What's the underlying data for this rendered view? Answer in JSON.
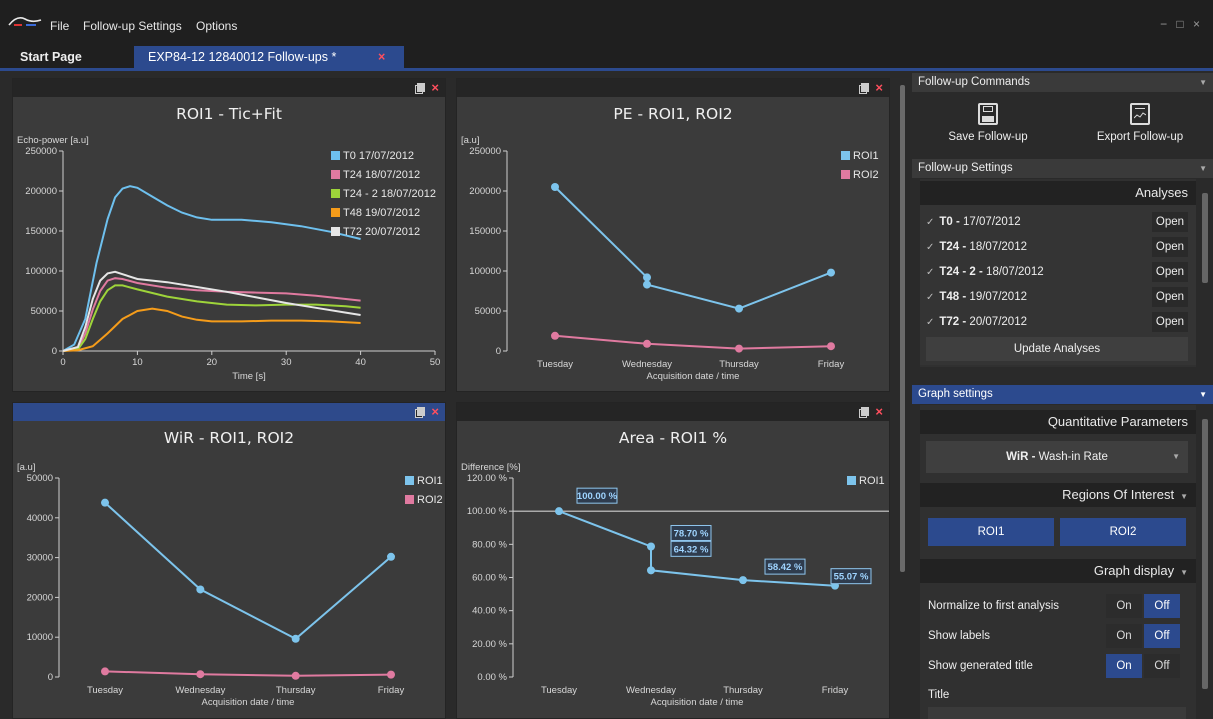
{
  "menu": {
    "items": [
      "File",
      "Follow-up Settings",
      "Options"
    ],
    "window_controls": "− □ ×"
  },
  "tabs": {
    "start": "Start Page",
    "doc": "EXP84-12 12840012 Follow-ups *",
    "close": "×"
  },
  "icons": {
    "panel_detach": "window-icon",
    "panel_close": "close-icon",
    "save": "floppy-disk-icon",
    "export": "clipboard-chart-icon"
  },
  "colors": {
    "accent": "#2c4a8e",
    "close": "#ff4f5e",
    "t0": "#6ec0ee",
    "t24": "#e07aa0",
    "t24_2": "#9ed43a",
    "t48": "#f59c1a",
    "t72": "#e6e6e6",
    "roi1": "#7dc4ec",
    "roi2": "#e07aa0"
  },
  "chart_data": [
    {
      "type": "line",
      "title": "ROI1 - Tic+Fit",
      "xlabel": "Time [s]",
      "ylabel": "Echo-power [a.u]",
      "xlim": [
        0,
        50
      ],
      "ylim": [
        0,
        250000
      ],
      "xticks": [
        "0",
        "10",
        "20",
        "30",
        "40",
        "50"
      ],
      "yticks": [
        "0",
        "50000",
        "100000",
        "150000",
        "200000",
        "250000"
      ],
      "legend": "top-right",
      "series": [
        {
          "name": "T0 17/07/2012",
          "x": [
            0,
            1.5,
            3,
            4.5,
            6,
            7,
            8,
            9,
            10,
            12,
            14,
            16,
            18,
            20,
            24,
            28,
            32,
            36,
            40
          ],
          "values": [
            0,
            8000,
            40000,
            110000,
            165000,
            192000,
            203000,
            206000,
            204000,
            193000,
            182000,
            173000,
            167000,
            164000,
            164000,
            161000,
            156000,
            149000,
            140000
          ]
        },
        {
          "name": "T24 18/07/2012",
          "x": [
            0,
            2,
            3,
            4,
            5,
            6,
            7,
            8,
            10,
            14,
            18,
            22,
            26,
            30,
            34,
            38,
            40
          ],
          "values": [
            0,
            3000,
            22000,
            52000,
            75000,
            88000,
            91000,
            90000,
            85000,
            79000,
            76000,
            74000,
            73000,
            72000,
            69000,
            65000,
            63000
          ]
        },
        {
          "name": "T24 - 2 18/07/2012",
          "x": [
            0,
            2,
            3,
            4,
            5,
            6,
            7,
            8,
            10,
            14,
            18,
            22,
            26,
            30,
            34,
            38,
            40
          ],
          "values": [
            0,
            2000,
            15000,
            40000,
            62000,
            76000,
            82000,
            82000,
            77000,
            68000,
            62000,
            58000,
            57000,
            58000,
            58000,
            56000,
            54000
          ]
        },
        {
          "name": "T48 19/07/2012",
          "x": [
            0,
            2,
            4,
            6,
            8,
            10,
            12,
            14,
            16,
            18,
            20,
            24,
            28,
            32,
            36,
            40
          ],
          "values": [
            0,
            1000,
            6000,
            22000,
            40000,
            50000,
            53000,
            50000,
            43000,
            39000,
            37000,
            37000,
            38000,
            38000,
            37000,
            35000
          ]
        },
        {
          "name": "T72 20/07/2012",
          "x": [
            0,
            2,
            3,
            4,
            5,
            6,
            7,
            8,
            10,
            14,
            18,
            22,
            26,
            30,
            34,
            38,
            40
          ],
          "values": [
            0,
            5000,
            30000,
            65000,
            88000,
            97000,
            99000,
            96000,
            90000,
            86000,
            80000,
            74000,
            67000,
            60000,
            54000,
            48000,
            45000
          ]
        }
      ]
    },
    {
      "type": "line",
      "title": "PE - ROI1, ROI2",
      "xlabel": "Acquisition date / time",
      "ylabel": "[a.u]",
      "ylim": [
        0,
        250000
      ],
      "categories": [
        "Tuesday",
        "Wednesday",
        "Thursday",
        "Friday"
      ],
      "yticks": [
        "0",
        "50000",
        "100000",
        "150000",
        "200000",
        "250000"
      ],
      "legend": "top-right",
      "series": [
        {
          "name": "ROI1",
          "x": [
            0,
            1,
            1,
            2,
            3
          ],
          "values": [
            205000,
            92000,
            83000,
            53000,
            98000
          ]
        },
        {
          "name": "ROI2",
          "x": [
            0,
            1,
            2,
            3
          ],
          "values": [
            19000,
            9000,
            3000,
            6000
          ]
        }
      ]
    },
    {
      "type": "line",
      "title": "WiR - ROI1, ROI2",
      "xlabel": "Acquisition date / time",
      "ylabel": "[a.u]",
      "ylim": [
        0,
        50000
      ],
      "categories": [
        "Tuesday",
        "Wednesday",
        "Thursday",
        "Friday"
      ],
      "yticks": [
        "0",
        "10000",
        "20000",
        "30000",
        "40000",
        "50000"
      ],
      "legend": "top-right",
      "series": [
        {
          "name": "ROI1",
          "x": [
            0,
            1,
            2,
            3
          ],
          "values": [
            43800,
            22000,
            9600,
            30200
          ]
        },
        {
          "name": "ROI2",
          "x": [
            0,
            1,
            2,
            3
          ],
          "values": [
            1400,
            700,
            300,
            600
          ]
        }
      ]
    },
    {
      "type": "line",
      "title": "Area - ROI1 %",
      "xlabel": "Acquisition date / time",
      "ylabel": "Difference [%]",
      "ylim": [
        0,
        120
      ],
      "categories": [
        "Tuesday",
        "Wednesday",
        "Thursday",
        "Friday"
      ],
      "yticks": [
        "0.00 %",
        "20.00 %",
        "40.00 %",
        "60.00 %",
        "80.00 %",
        "100.00 %",
        "120.00 %"
      ],
      "legend": "top-right",
      "reference_line": 100,
      "series": [
        {
          "name": "ROI1",
          "x": [
            0,
            1,
            1,
            2,
            3
          ],
          "values": [
            100,
            78.7,
            64.32,
            58.42,
            55.07
          ],
          "labels": [
            "100.00 %",
            "78.70 %",
            "64.32 %",
            "58.42 %",
            "55.07 %"
          ]
        }
      ]
    }
  ],
  "side": {
    "commands_header": "Follow-up Commands",
    "save_label": "Save Follow-up",
    "export_label": "Export Follow-up",
    "settings_header": "Follow-up Settings",
    "analyses_title": "Analyses",
    "analyses": [
      {
        "name": "T0 -",
        "date": " 17/07/2012",
        "open": "Open"
      },
      {
        "name": "T24 -",
        "date": " 18/07/2012",
        "open": "Open"
      },
      {
        "name": "T24 - 2 -",
        "date": " 18/07/2012",
        "open": "Open"
      },
      {
        "name": "T48 -",
        "date": " 19/07/2012",
        "open": "Open"
      },
      {
        "name": "T72 -",
        "date": " 20/07/2012",
        "open": "Open"
      }
    ],
    "check": "✓",
    "update_label": "Update Analyses",
    "graph_header": "Graph settings",
    "quant_title": "Quantitative Parameters",
    "param_bold": "WiR -",
    "param_rest": " Wash-in Rate",
    "roi_title": "Regions Of Interest",
    "roi_buttons": [
      "ROI1",
      "ROI2"
    ],
    "display_title": "Graph display",
    "display_rows": [
      {
        "label": "Normalize to first analysis",
        "on": "On",
        "off": "Off",
        "value": "Off"
      },
      {
        "label": "Show labels",
        "on": "On",
        "off": "Off",
        "value": "Off"
      },
      {
        "label": "Show generated title",
        "on": "On",
        "off": "Off",
        "value": "On"
      }
    ],
    "title_label": "Title"
  }
}
